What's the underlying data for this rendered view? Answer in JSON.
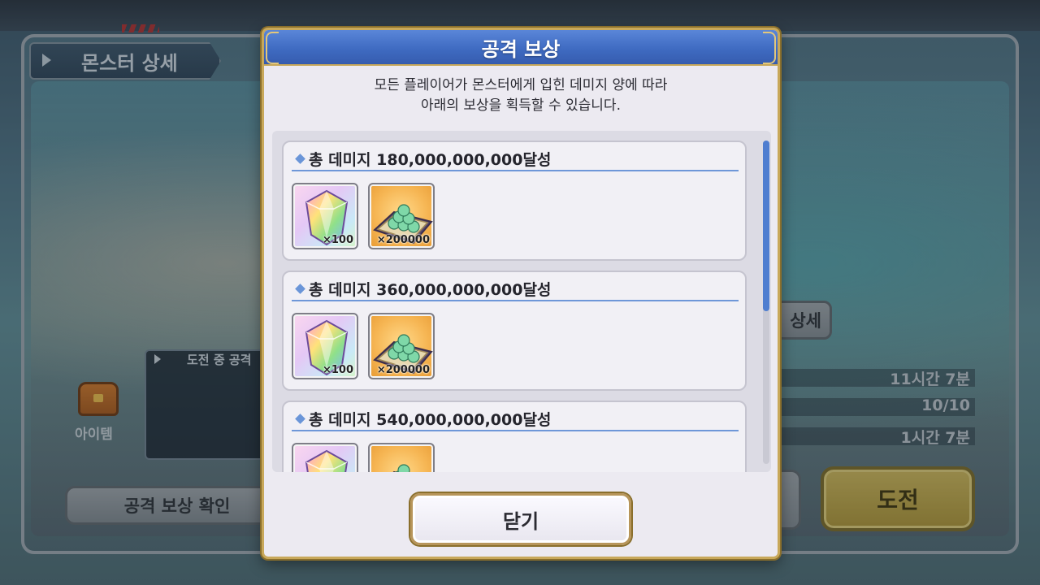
{
  "background": {
    "screen_title": "몬스터 상세",
    "item_label": "아이템",
    "attack_panel_label": "도전 중 공격",
    "reward_check_button": "공격 보상 확인",
    "detail_button": "상세",
    "stats": [
      "11시간 7분",
      "10/10",
      "1시간 7분"
    ],
    "challenge_button": "도전"
  },
  "modal": {
    "title": "공격 보상",
    "description_line1": "모든 플레이어가 몬스터에게 입힌 데미지 양에 따라",
    "description_line2": "아래의 보상을 획득할 수 있습니다.",
    "tiers": [
      {
        "title": "총 데미지 180,000,000,000달성",
        "rewards": [
          {
            "icon": "rainbow-gem-icon",
            "qty": "×100"
          },
          {
            "icon": "green-orb-pile-icon",
            "qty": "×200000"
          }
        ]
      },
      {
        "title": "총 데미지 360,000,000,000달성",
        "rewards": [
          {
            "icon": "rainbow-gem-icon",
            "qty": "×100"
          },
          {
            "icon": "green-orb-pile-icon",
            "qty": "×200000"
          }
        ]
      },
      {
        "title": "총 데미지 540,000,000,000달성",
        "rewards": [
          {
            "icon": "rainbow-gem-icon",
            "qty": ""
          },
          {
            "icon": "green-orb-pile-icon",
            "qty": ""
          }
        ]
      }
    ],
    "close_button": "닫기"
  },
  "colors": {
    "header_blue": "#3f6bc2",
    "gold_border": "#c8a85a",
    "tier_divider": "#6e97d8",
    "challenge_gold": "#c8b35a"
  }
}
